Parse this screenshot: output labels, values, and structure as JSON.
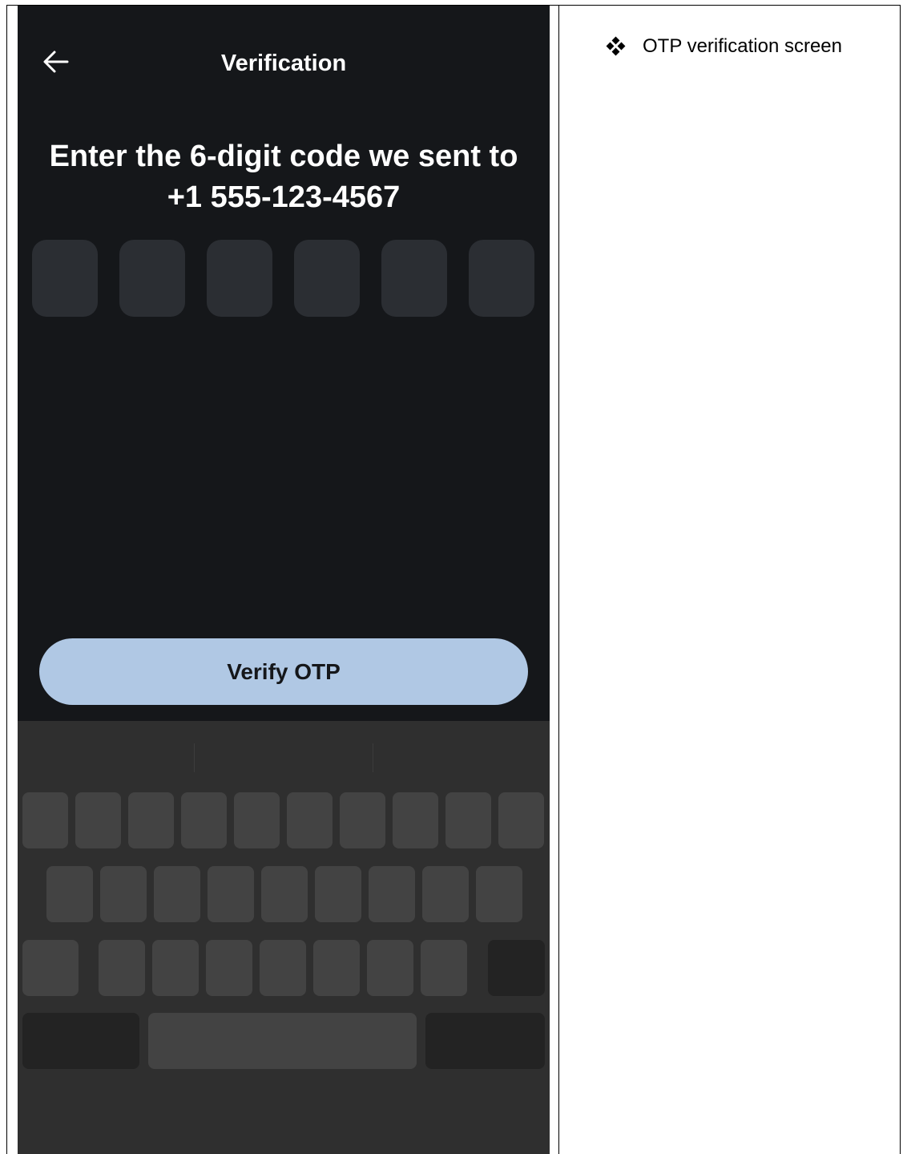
{
  "document": {
    "note_text": "OTP verification screen",
    "bullet_icon": "four-diamond-bullet-icon"
  },
  "app_bar": {
    "back_icon": "arrow-left-icon",
    "title": "Verification"
  },
  "otp": {
    "heading": "Enter the 6-digit code we sent to +1 555-123-4567",
    "digits": [
      "",
      "",
      "",
      "",
      "",
      ""
    ]
  },
  "verify_button": {
    "label": "Verify OTP"
  },
  "colors": {
    "screen_background": "#15171a",
    "otp_box": "#2b2e33",
    "button_background": "#b0c8e4",
    "keyboard_background": "#2f2f2f",
    "key": "#434343",
    "function_key": "#232323"
  }
}
